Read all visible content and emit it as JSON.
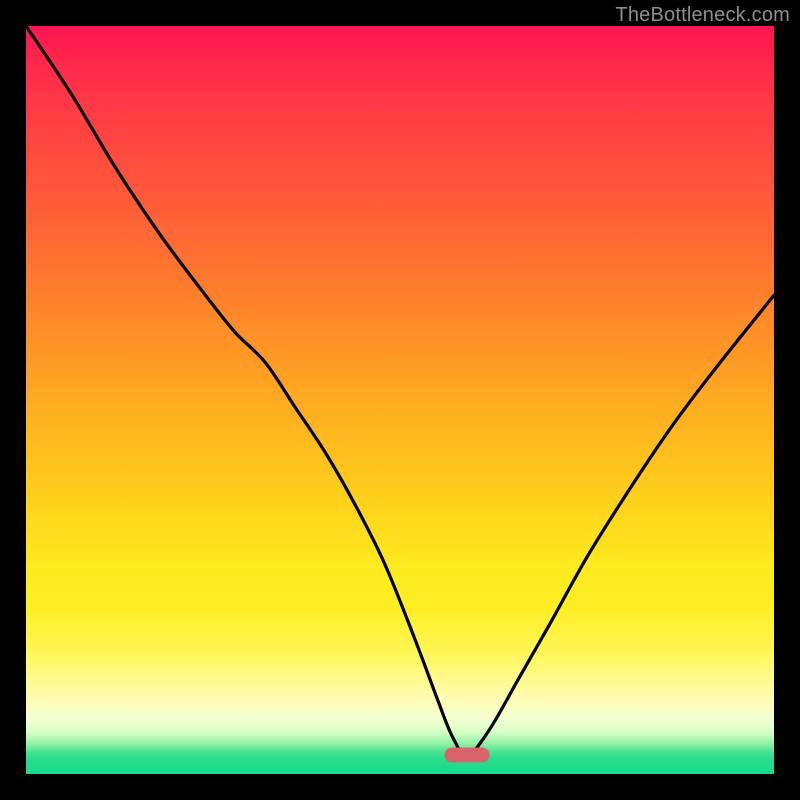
{
  "watermark": "TheBottleneck.com",
  "colors": {
    "frame": "#000000",
    "curve": "#000000",
    "marker": "#d9636a",
    "gradient_top": "#ff1451",
    "gradient_bottom": "#18da8b"
  },
  "chart_data": {
    "type": "line",
    "title": "",
    "xlabel": "",
    "ylabel": "",
    "xlim": [
      0,
      100
    ],
    "ylim": [
      0,
      100
    ],
    "grid": false,
    "legend": false,
    "marker": {
      "x": 59,
      "y": 2.5,
      "width_pct": 6,
      "height_pct": 2
    },
    "series": [
      {
        "name": "bottleneck-curve",
        "x": [
          0,
          6,
          12,
          18,
          24,
          28,
          32,
          36,
          40,
          44,
          48,
          52,
          55,
          57,
          59,
          62,
          66,
          70,
          75,
          80,
          86,
          92,
          100
        ],
        "y": [
          100,
          91,
          81,
          72,
          64,
          59,
          55,
          49,
          43,
          36,
          28,
          18,
          10,
          5,
          2.5,
          6,
          13,
          20,
          29,
          37,
          46,
          54,
          64
        ]
      }
    ],
    "notes": "V-shaped bottleneck curve over vertical red→green gradient; minimum marked by a small rounded red bar near x≈59%."
  }
}
